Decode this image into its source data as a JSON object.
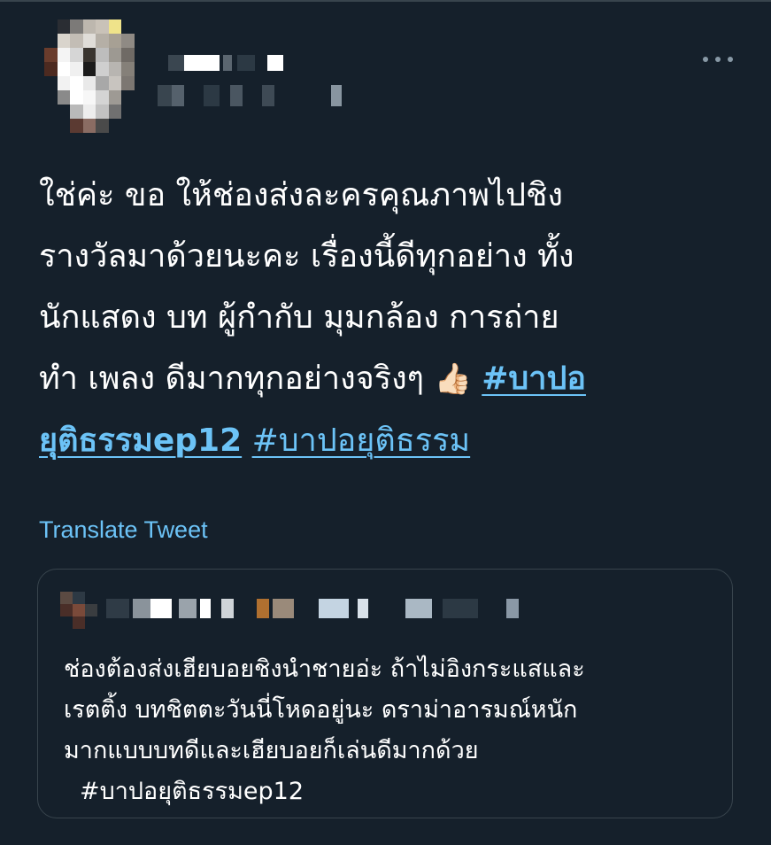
{
  "tweet": {
    "text_lines": [
      "ใช่ค่ะ ขอ ให้ช่องส่งละครคุณภาพไปชิง",
      "รางวัลมาด้วยนะคะ เรื่องนี้ดีทุกอย่าง ทั้ง",
      "นักแสดง บท ผู้กำกับ มุมกล้อง การถ่าย",
      "ทำ เพลง ดีมากทุกอย่างจริงๆ "
    ],
    "emoji": "👍🏻",
    "hashtag_1_part1": "#บาปอ",
    "hashtag_1_part2": "ยุติธรรมep12",
    "hashtag_2": "#บาปอยุติธรรม",
    "translate_label": "Translate Tweet",
    "more_icon": "more-horizontal-icon"
  },
  "quote": {
    "text_lines": [
      "ช่องต้องส่งเฮียบอยชิงนำชายอ่ะ ถ้าไม่อิงกระแสและ",
      "เรตติ้ง บทชิตตะวันนี่โหดอยู่นะ ดราม่าอารมณ์หนัก",
      "มากแบบบทดีและเฮียบอยก็เล่นดีมากด้วย"
    ],
    "hashtag": "#บาปอยุติธรรมep12"
  },
  "colors": {
    "background": "#15202b",
    "link": "#6cc3f7",
    "border": "#38444d",
    "muted": "#8899a6"
  }
}
